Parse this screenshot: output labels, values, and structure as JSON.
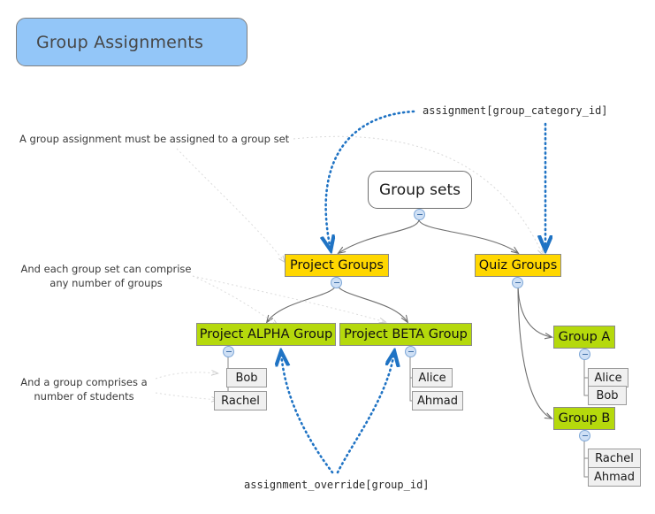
{
  "title": {
    "label": "Group Assignments"
  },
  "colors": {
    "title_fill": "#93c6f8",
    "group_set_fill": "#ffd700",
    "group_fill": "#b5d90c",
    "student_fill": "#f0f0f0",
    "blue_edge": "#1f73c4",
    "gray_edge": "#6e6e6e",
    "annot_edge": "#d9d9d9"
  },
  "nodes": {
    "root": {
      "label": "Group sets"
    },
    "group_sets": [
      {
        "label": "Project Groups"
      },
      {
        "label": "Quiz Groups"
      }
    ],
    "groups": [
      {
        "label": "Project ALPHA Group"
      },
      {
        "label": "Project BETA Group"
      },
      {
        "label": "Group A"
      },
      {
        "label": "Group B"
      }
    ],
    "students": [
      {
        "label": "Bob"
      },
      {
        "label": "Rachel"
      },
      {
        "label": "Alice"
      },
      {
        "label": "Ahmad"
      },
      {
        "label": "Alice"
      },
      {
        "label": "Bob"
      },
      {
        "label": "Rachel"
      },
      {
        "label": "Ahmad"
      }
    ]
  },
  "annotations": {
    "note_group_set": "A group assignment must be assigned to a group set",
    "note_comprise_line1": "And each group set can comprise",
    "note_comprise_line2": "any number of groups",
    "note_students_line1": "And a group comprises a",
    "note_students_line2": "number of students",
    "code_category": "assignment[group_category_id]",
    "code_override": "assignment_override[group_id]"
  },
  "icons": {
    "collapse": "minus-circle-icon"
  }
}
